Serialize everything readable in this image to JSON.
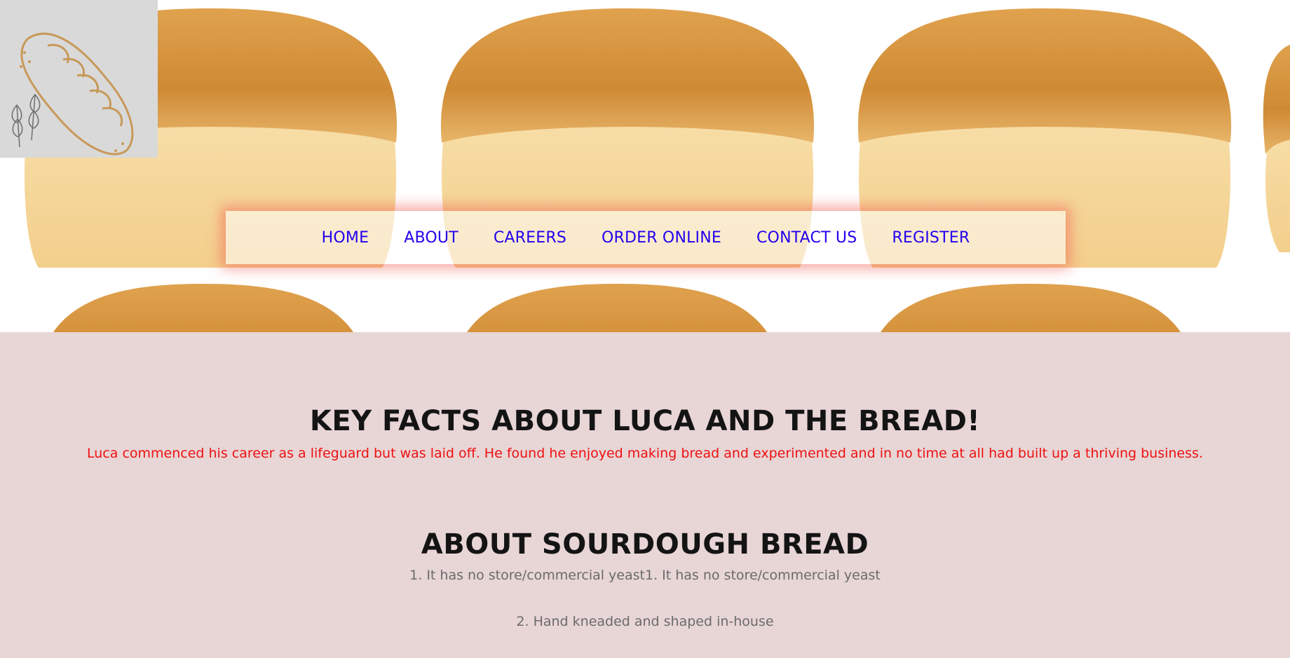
{
  "nav": {
    "items": [
      "HOME",
      "ABOUT",
      "CAREERS",
      "ORDER ONLINE",
      "CONTACT US",
      "REGISTER"
    ]
  },
  "colors": {
    "nav_link": "#2200ee",
    "intro_text": "#ee1111",
    "page_bg": "#e8d5d6",
    "logo_bg": "#d9d9d9",
    "logo_line": "#c8995a"
  },
  "icons": {
    "logo": "baguette-with-wheat-icon"
  },
  "main": {
    "heading": "KEY FACTS ABOUT LUCA AND THE BREAD!",
    "intro": "Luca commenced his career as a lifeguard but was laid off. He found he enjoyed making bread and experimented and in no time at all had built up a thriving business.",
    "section_heading": "ABOUT SOURDOUGH BREAD",
    "facts": [
      "1. It has no store/commercial yeast1. It has no store/commercial yeast",
      "2. Hand kneaded and shaped in-house"
    ]
  }
}
